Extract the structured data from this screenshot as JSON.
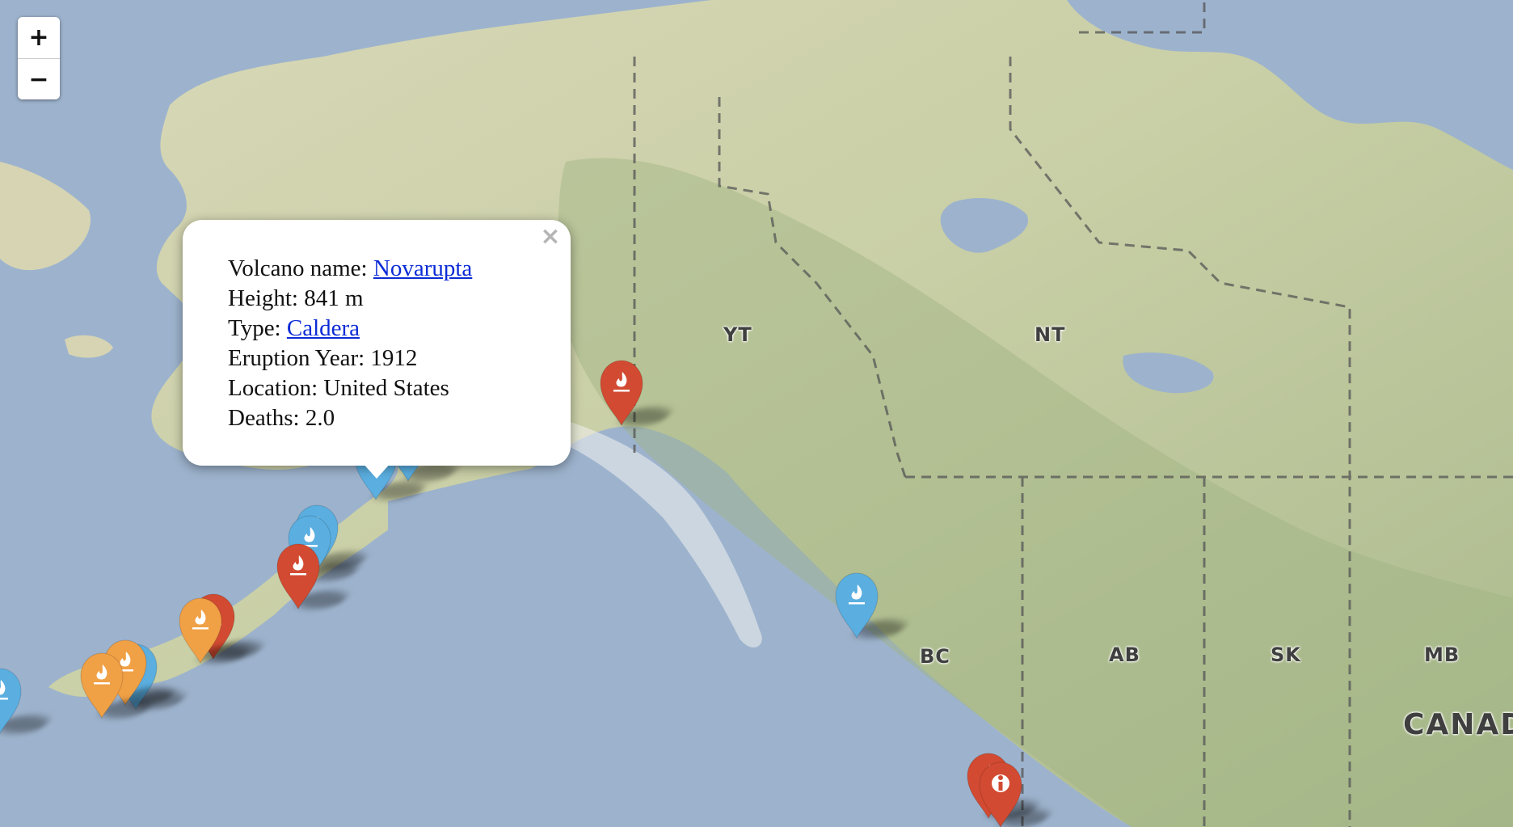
{
  "zoom": {
    "in_label": "+",
    "out_label": "−"
  },
  "regions": [
    {
      "id": "yt",
      "label": "YT"
    },
    {
      "id": "nt",
      "label": "NT"
    },
    {
      "id": "bc",
      "label": "BC"
    },
    {
      "id": "ab",
      "label": "AB"
    },
    {
      "id": "sk",
      "label": "SK"
    },
    {
      "id": "mb",
      "label": "MB"
    },
    {
      "id": "canada",
      "label": "CANAD"
    }
  ],
  "markers": [
    {
      "color": "#d24a31",
      "icon": "fire-icon"
    },
    {
      "color": "#5aaee0",
      "icon": "fire-icon"
    },
    {
      "color": "#5aaee0",
      "icon": "fire-icon"
    },
    {
      "color": "#5aaee0",
      "icon": "fire-icon"
    },
    {
      "color": "#5aaee0",
      "icon": "fire-icon"
    },
    {
      "color": "#d24a31",
      "icon": "fire-icon"
    },
    {
      "color": "#d24a31",
      "icon": "fire-icon"
    },
    {
      "color": "#f0a045",
      "icon": "fire-icon"
    },
    {
      "color": "#5aaee0",
      "icon": "fire-icon"
    },
    {
      "color": "#f0a045",
      "icon": "fire-icon"
    },
    {
      "color": "#f0a045",
      "icon": "fire-icon"
    },
    {
      "color": "#5aaee0",
      "icon": "fire-icon"
    },
    {
      "color": "#5aaee0",
      "icon": "fire-icon"
    },
    {
      "color": "#d24a31",
      "icon": "fire-icon"
    },
    {
      "color": "#d24a31",
      "icon": "info-icon"
    }
  ],
  "popup": {
    "close_label": "×",
    "name_label": "Volcano name: ",
    "name_value": "Novarupta",
    "height_label": "Height: 841 m",
    "type_label": "Type: ",
    "type_value": "Caldera",
    "eruption_label": "Eruption Year: 1912",
    "location_label": "Location: United States",
    "deaths_label": "Deaths: 2.0"
  }
}
